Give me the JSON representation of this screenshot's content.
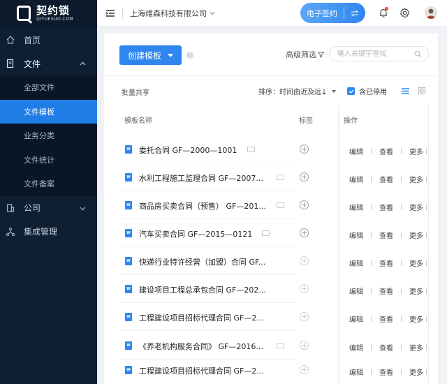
{
  "brand": {
    "name": "契约锁",
    "sub": "QIYUESUO.COM"
  },
  "sidebar": {
    "items": [
      {
        "label": "首页",
        "icon": "home-icon"
      },
      {
        "label": "文件",
        "icon": "file-icon"
      },
      {
        "label": "公司",
        "icon": "company-icon"
      },
      {
        "label": "集成管理",
        "icon": "integration-icon"
      }
    ],
    "file_sub": [
      "全部文件",
      "文件模板",
      "业务分类",
      "文件统计",
      "文件备案"
    ]
  },
  "header": {
    "company": "上海维森科技有限公司",
    "esign_label": "电子签约"
  },
  "toolbar": {
    "create_label": "创建模板",
    "help": "?",
    "advanced_filter": "高级筛选",
    "search_placeholder": "输入关键字查找",
    "batch_share": "批量共享",
    "sort_label": "排序：时间由近及远",
    "show_disabled": "含已停用"
  },
  "table": {
    "headers": {
      "name": "模板名称",
      "tag": "标签",
      "ops": "操作"
    },
    "ops": {
      "edit": "编辑",
      "view": "查看",
      "more": "更多"
    },
    "rows": [
      {
        "name": "委托合同   GF—2000—1001"
      },
      {
        "name": "水利工程施工监理合同   GF—2007..."
      },
      {
        "name": "商品房买卖合同（预售）   GF—201..."
      },
      {
        "name": "汽车买卖合同   GF—2015—0121"
      },
      {
        "name": "快递行业特许经营（加盟）合同   GF..."
      },
      {
        "name": "建设项目工程总承包合同   GF—202..."
      },
      {
        "name": "工程建设项目招标代理合同   GF—2..."
      },
      {
        "name": "《养老机构服务合同》   GF—2016..."
      },
      {
        "name": "工程建设项目招标代理合同   GF—2..."
      }
    ]
  }
}
